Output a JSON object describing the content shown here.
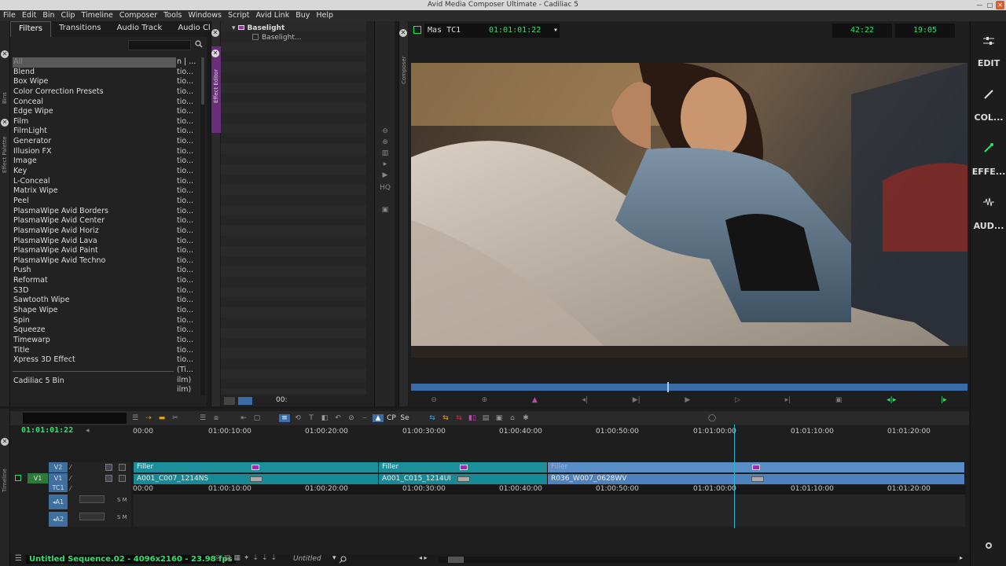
{
  "window": {
    "title": "Avid Media Composer Ultimate - Cadiliac 5"
  },
  "menu": [
    "File",
    "Edit",
    "Bin",
    "Clip",
    "Timeline",
    "Composer",
    "Tools",
    "Windows",
    "Script",
    "Avid Link",
    "Buy",
    "Help"
  ],
  "palette": {
    "tabs": [
      "Filters",
      "Transitions",
      "Audio Track",
      "Audio Clip"
    ],
    "categories": [
      "All",
      "Blend",
      "Box Wipe",
      "Color Correction Presets",
      "Conceal",
      "Edge Wipe",
      "Film",
      "FilmLight",
      "Generator",
      "Illusion FX",
      "Image",
      "Key",
      "L-Conceal",
      "Matrix Wipe",
      "Peel",
      "PlasmaWipe Avid Borders",
      "PlasmaWipe Avid Center",
      "PlasmaWipe Avid Horiz",
      "PlasmaWipe Avid Lava",
      "PlasmaWipe Avid Paint",
      "PlasmaWipe Avid Techno",
      "Push",
      "Reformat",
      "S3D",
      "Sawtooth Wipe",
      "Shape Wipe",
      "Spin",
      "Squeeze",
      "Timewarp",
      "Title",
      "Xpress 3D Effect"
    ],
    "bin_header": "n | ...",
    "bin_values": [
      "tio...",
      "tio...",
      "tio...",
      "tio...",
      "tio...",
      "tio...",
      "tio...",
      "tio...",
      "tio...",
      "tio...",
      "tio...",
      "tio...",
      "tio...",
      "tio...",
      "tio...",
      "tio...",
      "tio...",
      "tio...",
      "tio...",
      "tio...",
      "tio...",
      "tio...",
      "tio...",
      "tio...",
      "tio...",
      "tio...",
      "tio...",
      "tio...",
      "tio...",
      "tio..."
    ],
    "bin_tail": [
      "(Ti...",
      "ilm)",
      "ilm)"
    ],
    "bin_name": "Cadiliac 5 Bin",
    "strip_labels": [
      "Bins",
      "Effect Palette"
    ]
  },
  "effect_editor": {
    "label": "Effect Editor",
    "effect": "Baselight",
    "param": "Baselight...",
    "timecode": "00:"
  },
  "composer": {
    "label": "Composer",
    "track_label": "Mas  TC1",
    "timecode": "01:01:01:22",
    "duration": "42:22",
    "remaining": "19:05"
  },
  "workspaces": [
    "EDIT",
    "COL...",
    "EFFE...",
    "AUD..."
  ],
  "timeline": {
    "label": "Timeline",
    "master_tc": "01:01:01:22",
    "ruler": [
      "00:00",
      "01:00:10:00",
      "01:00:20:00",
      "01:00:30:00",
      "01:00:40:00",
      "01:00:50:00",
      "01:01:00:00",
      "01:01:10:00",
      "01:01:20:00"
    ],
    "tool_cp": "CP",
    "tool_se": "Se",
    "tracks": {
      "v2": "V2",
      "v1": "V1",
      "tc1": "TC1",
      "a1": "A1",
      "a2": "A2",
      "src_v1": "V1"
    },
    "v2_clips": [
      "Filler",
      "Filler",
      "Filler"
    ],
    "v1_clips": [
      "A001_C007_1214NS",
      "A001_C015_1214UI",
      "R036_W007_0628WV"
    ],
    "sequence": "Untitled Sequence.02 - 4096x2160 - 23.98 fps",
    "bin_dropdown": "Untitled"
  }
}
